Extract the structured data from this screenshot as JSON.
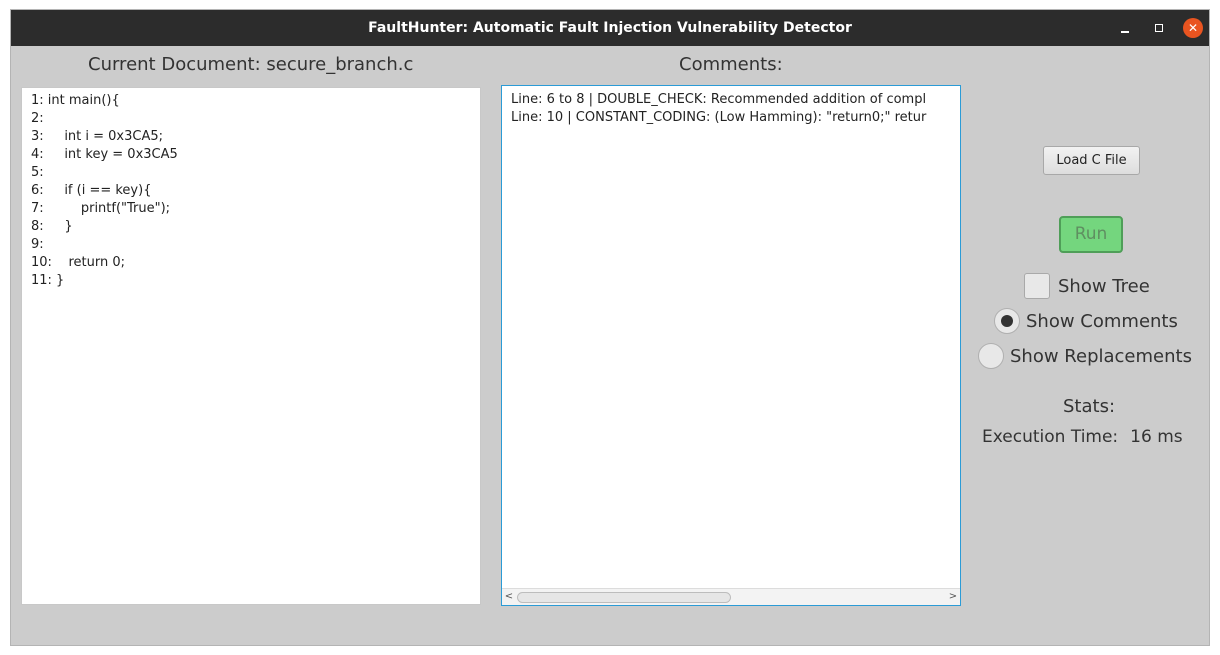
{
  "window": {
    "title": "FaultHunter: Automatic Fault Injection Vulnerability Detector",
    "controls": {
      "minimize_icon": "minimize-icon",
      "maximize_icon": "maximize-icon",
      "close_icon": "close-icon",
      "close_glyph": "✕",
      "close_color": "#e95420"
    }
  },
  "document": {
    "heading": "Current Document: secure_branch.c",
    "lines": [
      "1: int main(){",
      "2:",
      "3:     int i = 0x3CA5;",
      "4:     int key = 0x3CA5",
      "5:",
      "6:     if (i == key){",
      "7:         printf(\"True\");",
      "8:     }",
      "9:",
      "10:    return 0;",
      "11: }"
    ]
  },
  "comments": {
    "heading": "Comments:",
    "lines": [
      "Line: 6 to 8 | DOUBLE_CHECK: Recommended addition of compl",
      "Line: 10 | CONSTANT_CODING: (Low Hamming): \"return0;\" retur"
    ],
    "scroll_left_glyph": "<",
    "scroll_right_glyph": ">"
  },
  "controls": {
    "load_button": "Load C File",
    "run_button": "Run",
    "run_color": "#74d67e",
    "show_tree": {
      "label": "Show Tree",
      "checked": false
    },
    "show_comments": {
      "label": "Show Comments",
      "selected": true
    },
    "show_replacements": {
      "label": "Show Replacements",
      "selected": false
    }
  },
  "stats": {
    "label": "Stats:",
    "execution_time_label": "Execution Time:",
    "execution_time_value": "16 ms"
  }
}
